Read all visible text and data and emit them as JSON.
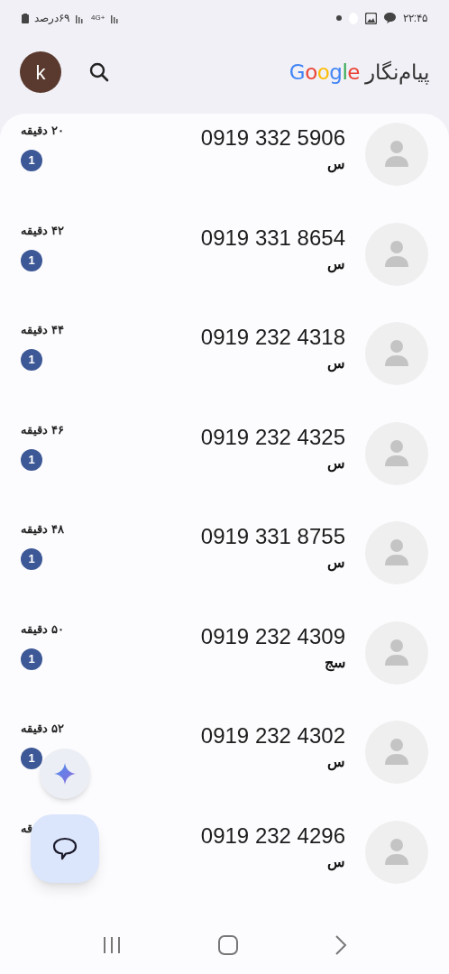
{
  "status_bar": {
    "time": "۲۲:۴۵",
    "battery": "۶۹درصد",
    "network": "4G+"
  },
  "header": {
    "app_name": "پیام‌نگار",
    "brand": "Google",
    "account_initial": "k"
  },
  "conversations": [
    {
      "phone": "0919 332 5906",
      "snippet": "س",
      "time": "۲۰ دقیقه",
      "unread": "1"
    },
    {
      "phone": "0919 331 8654",
      "snippet": "س",
      "time": "۴۲ دقیقه",
      "unread": "1"
    },
    {
      "phone": "0919 232 4318",
      "snippet": "س",
      "time": "۴۴ دقیقه",
      "unread": "1"
    },
    {
      "phone": "0919 232 4325",
      "snippet": "س",
      "time": "۴۶ دقیقه",
      "unread": "1"
    },
    {
      "phone": "0919 331 8755",
      "snippet": "س",
      "time": "۴۸ دقیقه",
      "unread": "1"
    },
    {
      "phone": "0919 232 4309",
      "snippet": "سج",
      "time": "۵۰ دقیقه",
      "unread": "1"
    },
    {
      "phone": "0919 232 4302",
      "snippet": "س",
      "time": "۵۲ دقیقه",
      "unread": "1"
    },
    {
      "phone": "0919 232 4296",
      "snippet": "س",
      "time": "قه"
    }
  ]
}
